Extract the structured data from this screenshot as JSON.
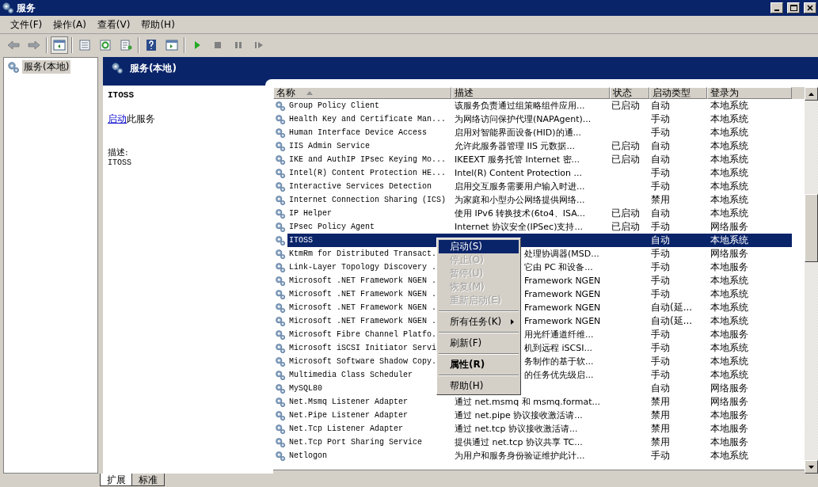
{
  "window": {
    "title": "服务"
  },
  "menu": [
    "文件(F)",
    "操作(A)",
    "查看(V)",
    "帮助(H)"
  ],
  "tree": [
    {
      "label": "服务(本地)",
      "selected": true
    }
  ],
  "panel": {
    "title": "服务(本地)",
    "service_name": "ITOSS",
    "action_link": "启动",
    "action_text": "此服务",
    "description_label": "描述:",
    "description": "ITOSS"
  },
  "table": {
    "columns": [
      {
        "label": "名称",
        "sorted": true
      },
      {
        "label": "描述",
        "sorted": false
      },
      {
        "label": "状态",
        "sorted": false
      },
      {
        "label": "启动类型",
        "sorted": false
      },
      {
        "label": "登录为",
        "sorted": false
      }
    ],
    "rows": [
      {
        "name": "Group Policy Client",
        "description": "该服务负责通过组策略组件应用...",
        "status": "已启动",
        "startup": "自动",
        "logon": "本地系统",
        "selected": false,
        "covered": false
      },
      {
        "name": "Health Key and Certificate Man...",
        "description": "为网络访问保护代理(NAPAgent)...",
        "startup": "手动",
        "logon": "本地系统",
        "selected": false,
        "covered": false
      },
      {
        "name": "Human Interface Device Access",
        "description": "启用对智能界面设备(HID)的通...",
        "startup": "手动",
        "logon": "本地系统",
        "selected": false,
        "covered": false
      },
      {
        "name": "IIS Admin Service",
        "description": "允许此服务器管理 IIS 元数据...",
        "status": "已启动",
        "startup": "自动",
        "logon": "本地系统",
        "selected": false,
        "covered": false
      },
      {
        "name": "IKE and AuthIP IPsec Keying Mo...",
        "description": "IKEEXT 服务托管 Internet 密...",
        "status": "已启动",
        "startup": "自动",
        "logon": "本地系统",
        "selected": false,
        "covered": false
      },
      {
        "name": "Intel(R) Content Protection HE...",
        "description": "Intel(R) Content Protection ...",
        "startup": "手动",
        "logon": "本地系统",
        "selected": false,
        "covered": false
      },
      {
        "name": "Interactive Services Detection",
        "description": "启用交互服务需要用户输入时进...",
        "startup": "手动",
        "logon": "本地系统",
        "selected": false,
        "covered": false
      },
      {
        "name": "Internet Connection Sharing (ICS)",
        "description": "为家庭和小型办公网络提供网络...",
        "startup": "禁用",
        "logon": "本地系统",
        "selected": false,
        "covered": false
      },
      {
        "name": "IP Helper",
        "description": "使用 IPv6 转换技术(6to4、ISA...",
        "status": "已启动",
        "startup": "自动",
        "logon": "本地系统",
        "selected": false,
        "covered": false
      },
      {
        "name": "IPsec Policy Agent",
        "description": "Internet 协议安全(IPSec)支持...",
        "status": "已启动",
        "startup": "手动",
        "logon": "网络服务",
        "selected": false,
        "covered": false
      },
      {
        "name": "ITOSS",
        "startup": "自动",
        "logon": "本地系统",
        "selected": true
      },
      {
        "name": "KtmRm for Distributed Transact.",
        "description": "处理协调器(MSD...",
        "startup": "手动",
        "logon": "网络服务",
        "selected": false,
        "covered": true
      },
      {
        "name": "Link-Layer Topology Discovery .",
        "description": "它由 PC 和设备...",
        "startup": "手动",
        "logon": "本地服务",
        "selected": false,
        "covered": true
      },
      {
        "name": "Microsoft .NET Framework NGEN .",
        "description": "Framework NGEN",
        "startup": "手动",
        "logon": "本地系统",
        "selected": false,
        "covered": true
      },
      {
        "name": "Microsoft .NET Framework NGEN .",
        "description": "Framework NGEN",
        "startup": "手动",
        "logon": "本地系统",
        "selected": false,
        "covered": true
      },
      {
        "name": "Microsoft .NET Framework NGEN .",
        "description": "Framework NGEN",
        "startup": "自动(延...",
        "logon": "本地系统",
        "selected": false,
        "covered": true
      },
      {
        "name": "Microsoft .NET Framework NGEN .",
        "description": "Framework NGEN",
        "startup": "自动(延...",
        "logon": "本地系统",
        "selected": false,
        "covered": true
      },
      {
        "name": "Microsoft Fibre Channel Platfo.",
        "description": "用光纤通道纤维...",
        "startup": "手动",
        "logon": "本地服务",
        "selected": false,
        "covered": true
      },
      {
        "name": "Microsoft iSCSI Initiator Servi",
        "description": "机到远程 iSCSI...",
        "startup": "手动",
        "logon": "本地系统",
        "selected": false,
        "covered": true
      },
      {
        "name": "Microsoft Software Shadow Copy.",
        "description": "务制作的基于软...",
        "startup": "手动",
        "logon": "本地系统",
        "selected": false,
        "covered": true
      },
      {
        "name": "Multimedia Class Scheduler",
        "description": "的任务优先级启...",
        "startup": "手动",
        "logon": "本地系统",
        "selected": false,
        "covered": true
      },
      {
        "name": "MySQL80",
        "startup": "自动",
        "logon": "网络服务",
        "selected": false
      },
      {
        "name": "Net.Msmq Listener Adapter",
        "description": "通过 net.msmq 和 msmq.format...",
        "startup": "禁用",
        "logon": "网络服务",
        "selected": false,
        "covered": false
      },
      {
        "name": "Net.Pipe Listener Adapter",
        "description": "通过 net.pipe 协议接收激活请...",
        "startup": "禁用",
        "logon": "本地服务",
        "selected": false,
        "covered": false
      },
      {
        "name": "Net.Tcp Listener Adapter",
        "description": "通过 net.tcp 协议接收激活请...",
        "startup": "禁用",
        "logon": "本地服务",
        "selected": false,
        "covered": false
      },
      {
        "name": "Net.Tcp Port Sharing Service",
        "description": "提供通过 net.tcp 协议共享 TC...",
        "startup": "禁用",
        "logon": "本地服务",
        "selected": false,
        "covered": false
      },
      {
        "name": "Netlogon",
        "description": "为用户和服务身份验证维护此计...",
        "startup": "手动",
        "logon": "本地系统",
        "selected": false,
        "covered": false
      }
    ]
  },
  "context_menu": [
    {
      "kind": "item",
      "label": "启动(S)",
      "selected": true,
      "disabled": false,
      "default": false
    },
    {
      "kind": "item",
      "label": "停止(O)",
      "selected": false,
      "disabled": true,
      "default": false
    },
    {
      "kind": "item",
      "label": "暂停(U)",
      "selected": false,
      "disabled": true,
      "default": false
    },
    {
      "kind": "item",
      "label": "恢复(M)",
      "selected": false,
      "disabled": true,
      "default": false
    },
    {
      "kind": "item",
      "label": "重新启动(E)",
      "selected": false,
      "disabled": true,
      "default": false
    },
    {
      "kind": "separator"
    },
    {
      "kind": "submenu",
      "label": "所有任务(K)",
      "selected": false,
      "disabled": false,
      "default": false
    },
    {
      "kind": "separator"
    },
    {
      "kind": "item",
      "label": "刷新(F)",
      "selected": false,
      "disabled": false,
      "default": false
    },
    {
      "kind": "separator"
    },
    {
      "kind": "item",
      "label": "属性(R)",
      "selected": false,
      "disabled": false,
      "default": true
    },
    {
      "kind": "separator"
    },
    {
      "kind": "item",
      "label": "帮助(H)",
      "selected": false,
      "disabled": false,
      "default": false
    }
  ],
  "view_tabs": [
    {
      "label": "扩展",
      "selected": true
    },
    {
      "label": "标准",
      "selected": false
    }
  ]
}
